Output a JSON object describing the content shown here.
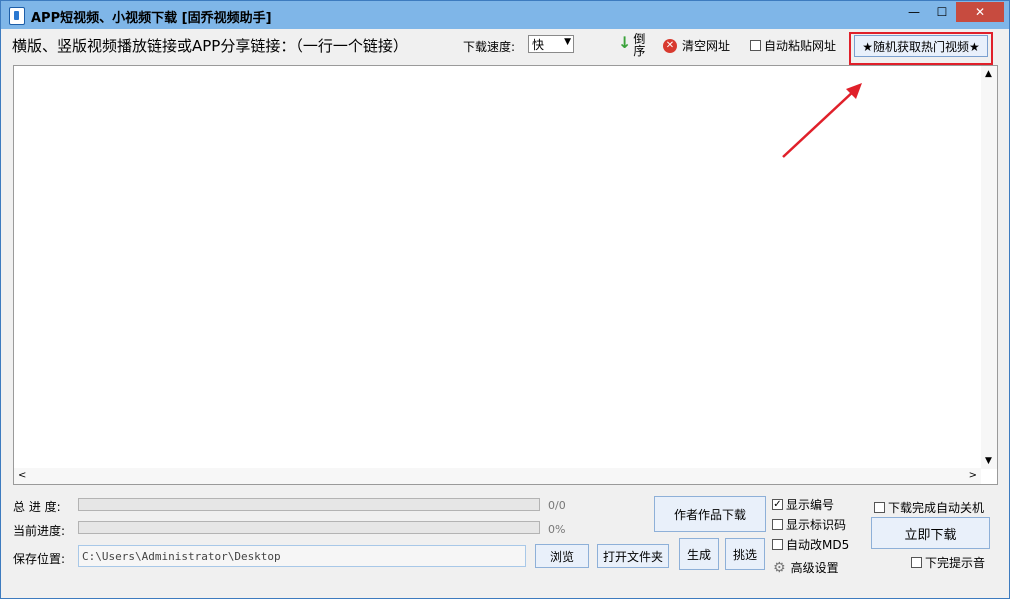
{
  "window": {
    "title": "APP短视频、小视频下载 [固乔视频助手]"
  },
  "toolbar": {
    "links_label": "横版、竖版视频播放链接或APP分享链接：（一行一个链接）",
    "speed_label": "下载速度:",
    "speed_value": "快",
    "reverse_label": "倒序",
    "clear_label": "清空网址",
    "autopaste_label": "自动粘贴网址",
    "autopaste_checked": false,
    "hot_button_label": "★随机获取热门视频★"
  },
  "annotation": {
    "highlight_color": "#e0202a"
  },
  "progress": {
    "total_label": "总 进 度:",
    "total_text": "0/0",
    "total_value": 0,
    "current_label": "当前进度:",
    "current_text": "0%",
    "current_value": 0
  },
  "save": {
    "label": "保存位置:",
    "path": "C:\\Users\\Administrator\\Desktop",
    "browse_label": "浏览",
    "open_folder_label": "打开文件夹"
  },
  "actions": {
    "author_download_label": "作者作品下载",
    "generate_label": "生成",
    "pick_label": "挑选",
    "download_now_label": "立即下载"
  },
  "options": {
    "show_number": {
      "label": "显示编号",
      "checked": true
    },
    "show_id": {
      "label": "显示标识码",
      "checked": false
    },
    "auto_md5": {
      "label": "自动改MD5",
      "checked": false
    },
    "advanced_label": "高级设置",
    "auto_shutdown": {
      "label": "下载完成自动关机",
      "checked": false
    },
    "done_sound": {
      "label": "下完提示音",
      "checked": false
    }
  }
}
